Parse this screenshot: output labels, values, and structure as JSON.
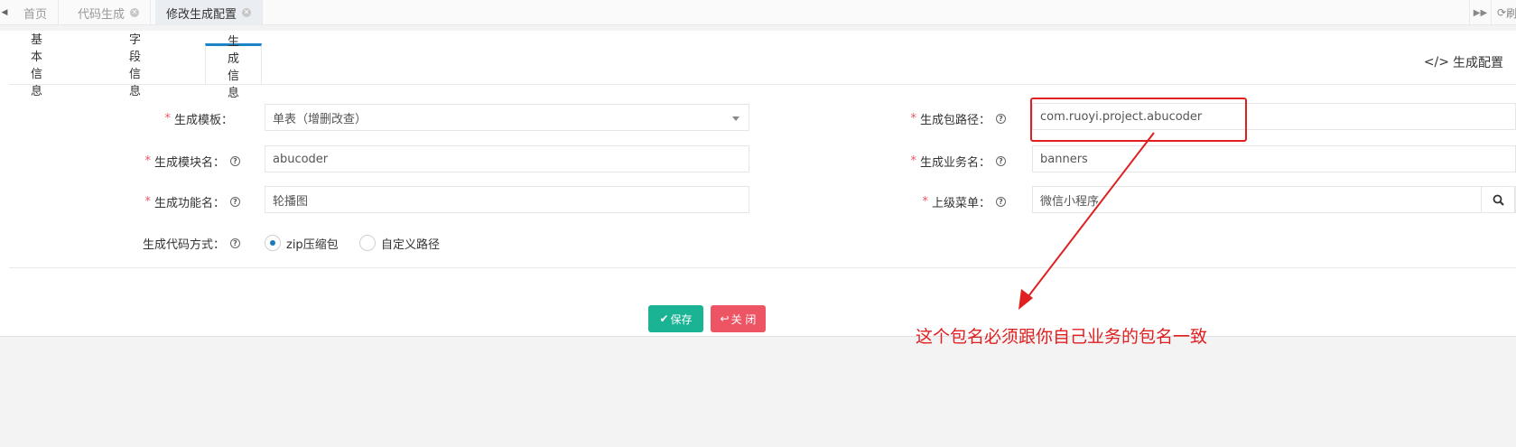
{
  "top_tabs": [
    {
      "label": "首页",
      "closable": false,
      "active": false
    },
    {
      "label": "代码生成",
      "closable": true,
      "active": false
    },
    {
      "label": "修改生成配置",
      "closable": true,
      "active": true
    }
  ],
  "top_right": {
    "refresh_label": "刷"
  },
  "tabs": [
    {
      "label": "基本信息",
      "active": false
    },
    {
      "label": "字段信息",
      "active": false
    },
    {
      "label": "生成信息",
      "active": true
    }
  ],
  "header": {
    "gen_config_label": "生成配置"
  },
  "form": {
    "template": {
      "label": "生成模板：",
      "value": "单表（增删改查）"
    },
    "module_name": {
      "label": "生成模块名：",
      "value": "abucoder"
    },
    "function_name": {
      "label": "生成功能名：",
      "value": "轮播图"
    },
    "code_mode": {
      "label": "生成代码方式：",
      "options": [
        {
          "label": "zip压缩包",
          "checked": true
        },
        {
          "label": "自定义路径",
          "checked": false
        }
      ]
    },
    "package_path": {
      "label": "生成包路径：",
      "value": "com.ruoyi.project.abucoder"
    },
    "business_name": {
      "label": "生成业务名：",
      "value": "banners"
    },
    "parent_menu": {
      "label": "上级菜单：",
      "value": "微信小程序"
    }
  },
  "buttons": {
    "save_label": "保存",
    "close_label": "关 闭"
  },
  "annotation": {
    "text": "这个包名必须跟你自己业务的包名一致"
  },
  "colors": {
    "accent": "#1c84c6",
    "save": "#1ab394",
    "close": "#ed5565",
    "annotation": "#e02020"
  }
}
